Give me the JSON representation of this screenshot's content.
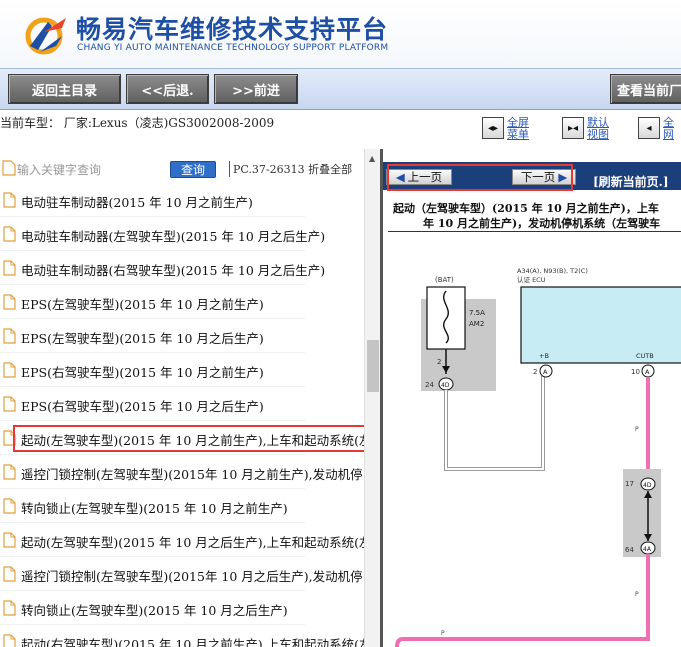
{
  "header": {
    "brand_cn": "畅易汽车维修技术支持平台",
    "brand_en": "CHANG YI AUTO MAINTENANCE TECHNOLOGY SUPPORT PLATFORM"
  },
  "toolbar": {
    "home": "返回主目录",
    "back": "<<后退.",
    "forward": ">>前进",
    "view_current": "查看当前厂"
  },
  "info": {
    "car_model": "当前车型： 厂家:Lexus（凌志)GS3002008-2009",
    "view_buttons": [
      {
        "line1": "全屏",
        "line2": "菜单"
      },
      {
        "line1": "默认",
        "line2": "视图"
      },
      {
        "line1": "全",
        "line2": "网"
      }
    ]
  },
  "search": {
    "placeholder": "输入关键字查询",
    "button": "查询",
    "code": "PC.37-26313",
    "collapse": "折叠全部"
  },
  "tree": {
    "items": [
      "电动驻车制动器(2015 年 10 月之前生产)",
      "电动驻车制动器(左驾驶车型)(2015 年 10 月之后生产)",
      "电动驻车制动器(右驾驶车型)(2015 年 10 月之后生产)",
      "EPS(左驾驶车型)(2015 年 10 月之前生产)",
      "EPS(左驾驶车型)(2015 年 10 月之后生产)",
      "EPS(右驾驶车型)(2015 年 10 月之前生产)",
      "EPS(右驾驶车型)(2015 年 10 月之后生产)",
      "起动(左驾驶车型)(2015 年 10 月之前生产),上车和起动系统(左",
      "遥控门锁控制(左驾驶车型)(2015年 10 月之前生产),发动机停",
      "转向锁止(左驾驶车型)(2015 年 10 月之前生产)",
      "起动(左驾驶车型)(2015 年 10 月之后生产),上车和起动系统(左",
      "遥控门锁控制(左驾驶车型)(2015年 10 月之后生产),发动机停",
      "转向锁止(左驾驶车型)(2015 年 10 月之后生产)",
      "起动(右驾驶车型)(2015 年 10 月之前生产),上车和起动系统(左"
    ]
  },
  "viewer": {
    "prev": "上一页",
    "next": "下一页",
    "refresh": "[刷新当前页.]",
    "title_line1": "起动（左驾驶车型）(2015 年 10 月之前生产)，上车",
    "title_line2": "年 10 月之前生产)，发动机停机系统（左驾驶车",
    "labels": {
      "bat": "(BAT)",
      "fuse_amp": "7.5A",
      "fuse_name": "AM2",
      "pin_2": "2",
      "conn_24": "24",
      "conn_4d_a": "4D",
      "ecu_code": "A34(A), N93(B), T2(C)",
      "ecu_name": "认证 ECU",
      "plus_b": "+B",
      "cutb": "CUTB",
      "pin_2a": "2",
      "pin_a_1": "A",
      "pin_10": "10",
      "pin_a_2": "A",
      "conn_17": "17",
      "conn_4d_b": "4D",
      "conn_64": "64",
      "conn_4a": "4A",
      "wire_p": "P"
    }
  },
  "colors": {
    "brand_blue": "#1f4fa3",
    "nav_dark": "#1a3f7a",
    "highlight_red": "#e53935",
    "wire_pink": "#f06fb0",
    "ecu_fill": "#c7ecf4"
  }
}
